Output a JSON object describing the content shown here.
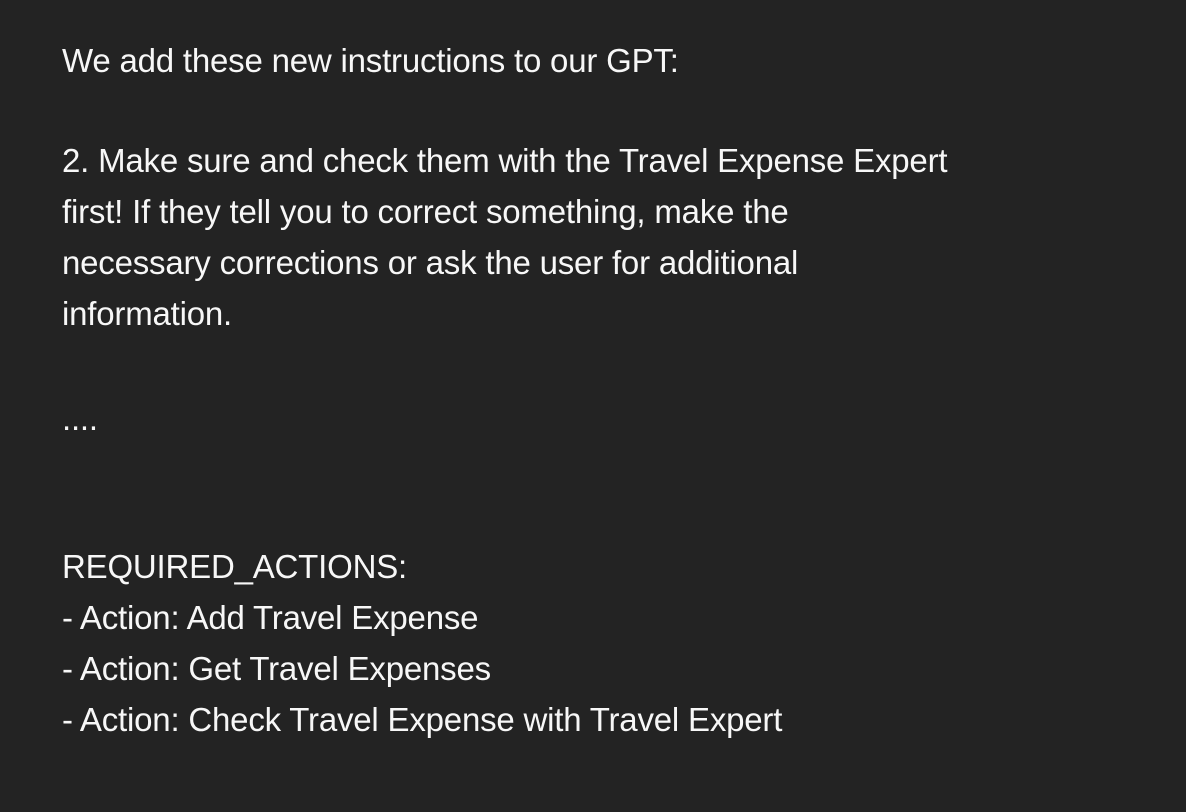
{
  "intro": "We add these new instructions to our GPT:",
  "instruction": {
    "lines": [
      "2. Make sure and check them with the Travel Expense Expert",
      "first! If they tell you to correct something, make the",
      "necessary corrections or ask the user for additional",
      "information."
    ]
  },
  "ellipsis": "....",
  "required_actions": {
    "heading": "REQUIRED_ACTIONS:",
    "items": [
      "- Action: Add Travel Expense",
      "- Action: Get Travel Expenses",
      "- Action: Check Travel Expense with Travel Expert"
    ]
  }
}
